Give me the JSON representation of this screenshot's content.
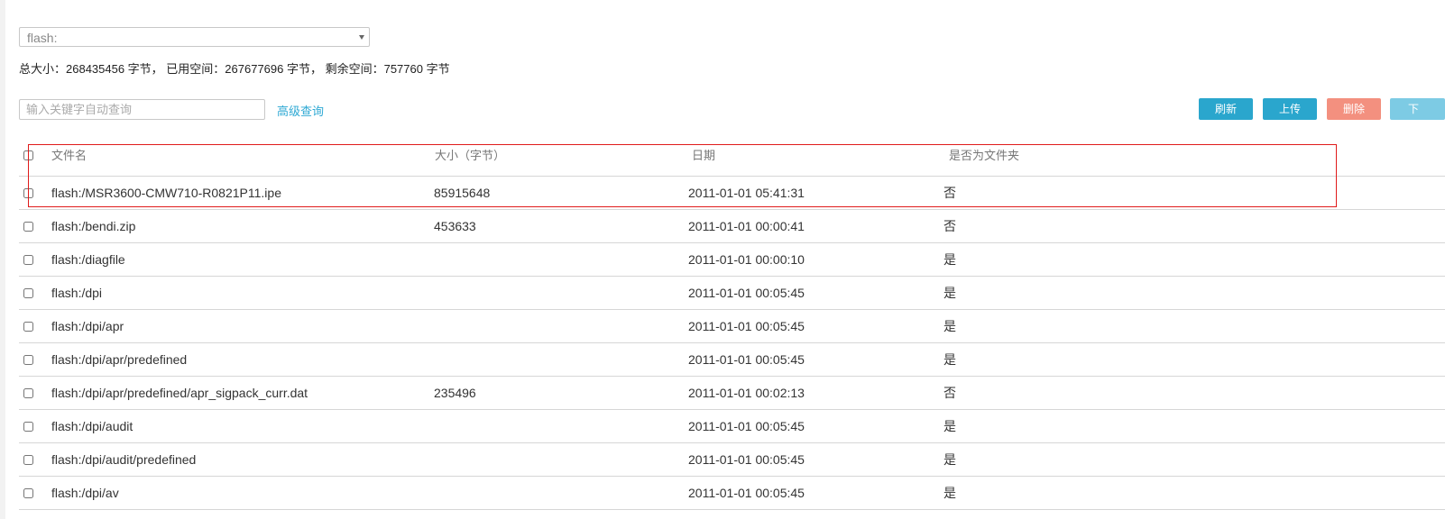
{
  "device": {
    "selected": "flash:"
  },
  "space_info": "总大小：268435456 字节， 已用空间：267677696 字节， 剩余空间：757760 字节",
  "search": {
    "placeholder": "输入关键字自动查询",
    "advanced_label": "高级查询"
  },
  "toolbar": {
    "refresh_label": "刷新",
    "upload_label": "上传",
    "delete_label": "删除",
    "download_label": "下"
  },
  "table": {
    "columns": [
      "文件名",
      "大小（字节）",
      "日期",
      "是否为文件夹"
    ],
    "rows": [
      {
        "name": "flash:/MSR3600-CMW710-R0821P11.ipe",
        "size": "85915648",
        "date": "2011-01-01 05:41:31",
        "is_dir": "否"
      },
      {
        "name": "flash:/bendi.zip",
        "size": "453633",
        "date": "2011-01-01 00:00:41",
        "is_dir": "否"
      },
      {
        "name": "flash:/diagfile",
        "size": "",
        "date": "2011-01-01 00:00:10",
        "is_dir": "是"
      },
      {
        "name": "flash:/dpi",
        "size": "",
        "date": "2011-01-01 00:05:45",
        "is_dir": "是"
      },
      {
        "name": "flash:/dpi/apr",
        "size": "",
        "date": "2011-01-01 00:05:45",
        "is_dir": "是"
      },
      {
        "name": "flash:/dpi/apr/predefined",
        "size": "",
        "date": "2011-01-01 00:05:45",
        "is_dir": "是"
      },
      {
        "name": "flash:/dpi/apr/predefined/apr_sigpack_curr.dat",
        "size": "235496",
        "date": "2011-01-01 00:02:13",
        "is_dir": "否"
      },
      {
        "name": "flash:/dpi/audit",
        "size": "",
        "date": "2011-01-01 00:05:45",
        "is_dir": "是"
      },
      {
        "name": "flash:/dpi/audit/predefined",
        "size": "",
        "date": "2011-01-01 00:05:45",
        "is_dir": "是"
      },
      {
        "name": "flash:/dpi/av",
        "size": "",
        "date": "2011-01-01 00:05:45",
        "is_dir": "是"
      }
    ]
  },
  "colors": {
    "primary_button": "#2aa6cd",
    "delete_button": "#f3907f",
    "link": "#2fa9d4",
    "highlight_border": "#e01b1b"
  }
}
